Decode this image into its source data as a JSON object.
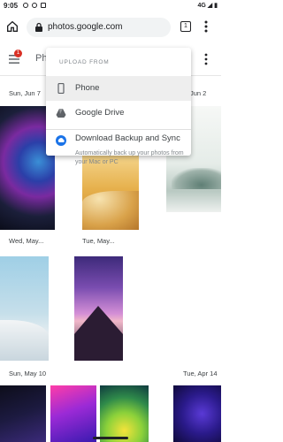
{
  "status_bar": {
    "time": "9:05",
    "network": "4G"
  },
  "browser": {
    "url": "photos.google.com",
    "tab_count": "1"
  },
  "header": {
    "title_partial": "Ph",
    "notification_count": "1"
  },
  "dates": {
    "d1": "Sun, Jun 7",
    "d2": "Jun 2",
    "d3": "Wed, May...",
    "d4": "Tue, May...",
    "d5": "Sun, May 10",
    "d6": "Tue, Apr 14"
  },
  "dropdown": {
    "header": "UPLOAD FROM",
    "items": [
      {
        "label": "Phone",
        "icon": "phone-icon",
        "selected": true
      },
      {
        "label": "Google Drive",
        "icon": "google-drive-icon"
      },
      {
        "label": "Download Backup and Sync",
        "sub": "Automatically back up your photos from your Mac or PC",
        "icon": "backup-sync-icon"
      }
    ]
  },
  "colors": {
    "accent": "#1a73e8",
    "badge": "#d93025"
  }
}
